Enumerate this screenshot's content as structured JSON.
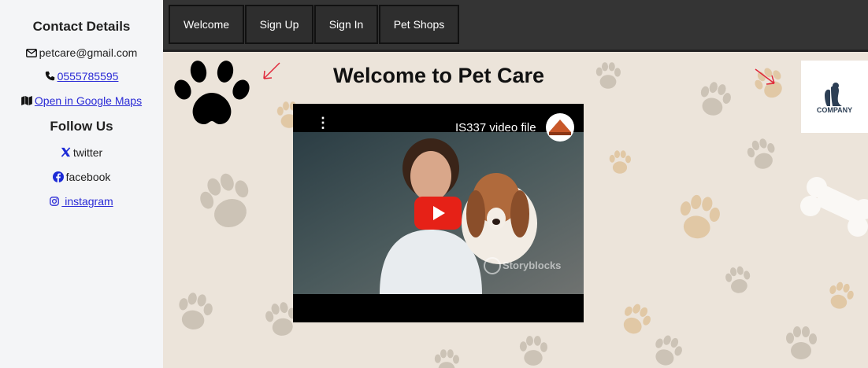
{
  "sidebar": {
    "contact_title": "Contact Details",
    "email": "petcare@gmail.com",
    "phone": "0555785595",
    "maps_link": "Open in Google Maps",
    "follow_title": "Follow Us",
    "social": {
      "twitter": "twitter",
      "facebook": "facebook",
      "instagram": " instagram"
    },
    "icons": {
      "email": "envelope-icon",
      "phone": "phone-icon",
      "maps": "map-icon",
      "twitter": "x-icon",
      "facebook": "facebook-icon",
      "instagram": "instagram-icon"
    }
  },
  "nav": {
    "items": [
      "Welcome",
      "Sign Up",
      "Sign In",
      "Pet Shops"
    ]
  },
  "main": {
    "title": "Welcome to Pet Care",
    "video": {
      "title": "IS337 video file",
      "watermark": "Storyblocks"
    },
    "logo": {
      "text": "COMPANY"
    }
  },
  "colors": {
    "nav_bg": "#343434",
    "sidebar_bg": "#f4f5f7",
    "page_bg": "#ece4da",
    "link": "#2a2ad6",
    "play_button": "#e62117",
    "arrow": "#e0283a"
  }
}
